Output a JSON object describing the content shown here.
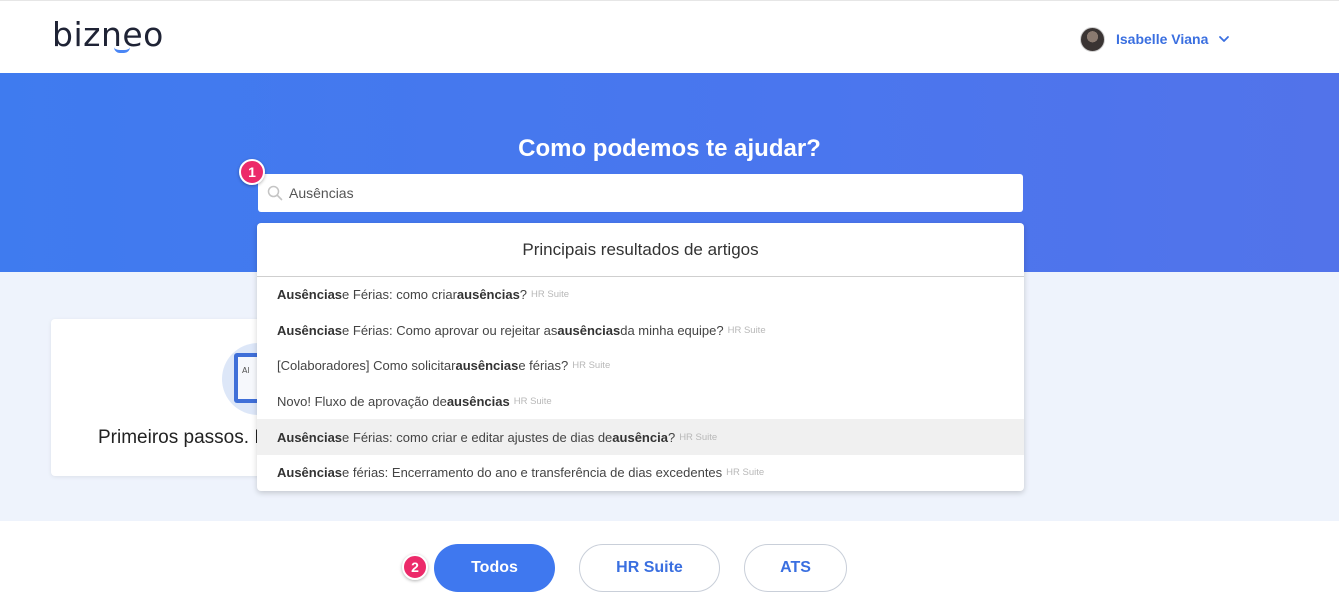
{
  "header": {
    "logo_text": "bizneo",
    "user_name": "Isabelle Viana"
  },
  "hero": {
    "title": "Como podemos te ajudar?"
  },
  "search": {
    "value": "Ausências",
    "marker": "1"
  },
  "dropdown": {
    "header": "Principais resultados de artigos",
    "items": [
      {
        "parts": [
          {
            "t": "Ausências",
            "b": true
          },
          {
            "t": " e Férias: como criar ",
            "b": false
          },
          {
            "t": "ausências",
            "b": true
          },
          {
            "t": "?",
            "b": false
          }
        ],
        "tag": "HR Suite",
        "highlighted": false
      },
      {
        "parts": [
          {
            "t": "Ausências",
            "b": true
          },
          {
            "t": " e Férias: Como aprovar ou rejeitar as ",
            "b": false
          },
          {
            "t": "ausências",
            "b": true
          },
          {
            "t": " da minha equipe?",
            "b": false
          }
        ],
        "tag": "HR Suite",
        "highlighted": false
      },
      {
        "parts": [
          {
            "t": "[Colaboradores] Como solicitar ",
            "b": false
          },
          {
            "t": "ausências",
            "b": true
          },
          {
            "t": " e férias?",
            "b": false
          }
        ],
        "tag": "HR Suite",
        "highlighted": false
      },
      {
        "parts": [
          {
            "t": "Novo! Fluxo de aprovação de ",
            "b": false
          },
          {
            "t": "ausências",
            "b": true
          }
        ],
        "tag": "HR Suite",
        "highlighted": false
      },
      {
        "parts": [
          {
            "t": "Ausências",
            "b": true
          },
          {
            "t": " e Férias: como criar e editar ajustes de dias de ",
            "b": false
          },
          {
            "t": "ausência",
            "b": true
          },
          {
            "t": "?",
            "b": false
          }
        ],
        "tag": "HR Suite",
        "highlighted": true
      },
      {
        "parts": [
          {
            "t": "Ausências",
            "b": true
          },
          {
            "t": " e férias: Encerramento do ano e transferência de dias excedentes",
            "b": false
          }
        ],
        "tag": "HR Suite",
        "highlighted": false
      }
    ]
  },
  "card": {
    "title": "Primeiros passos. I"
  },
  "filters": {
    "marker": "2",
    "buttons": [
      {
        "label": "Todos",
        "active": true
      },
      {
        "label": "HR Suite",
        "active": false
      },
      {
        "label": "ATS",
        "active": false
      }
    ]
  },
  "colors": {
    "accent": "#3f78ef",
    "marker": "#ec2a6a",
    "hero_bg": "#4a76ee"
  }
}
